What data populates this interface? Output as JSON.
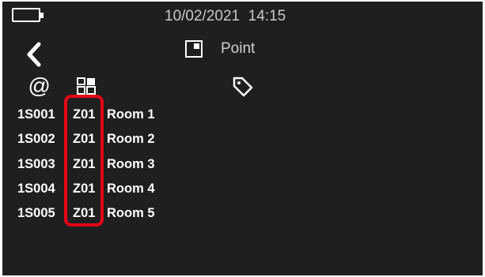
{
  "status": {
    "datetime": "10/02/2021  14:15"
  },
  "header": {
    "mode_label": "Point"
  },
  "icons": {
    "battery": "battery-icon",
    "back": "back-chevron-icon",
    "mode": "point-mode-icon",
    "address": "at-sign-icon",
    "zone": "grid-icon",
    "label": "tag-icon"
  },
  "points": [
    {
      "id": "1S001",
      "zone": "Z01",
      "room": "Room 1"
    },
    {
      "id": "1S002",
      "zone": "Z01",
      "room": "Room 2"
    },
    {
      "id": "1S003",
      "zone": "Z01",
      "room": "Room 3"
    },
    {
      "id": "1S004",
      "zone": "Z01",
      "room": "Room 4"
    },
    {
      "id": "1S005",
      "zone": "Z01",
      "room": "Room 5"
    }
  ],
  "colors": {
    "background": "#1f1f1f",
    "highlight": "#e30613",
    "text": "#ffffff"
  }
}
